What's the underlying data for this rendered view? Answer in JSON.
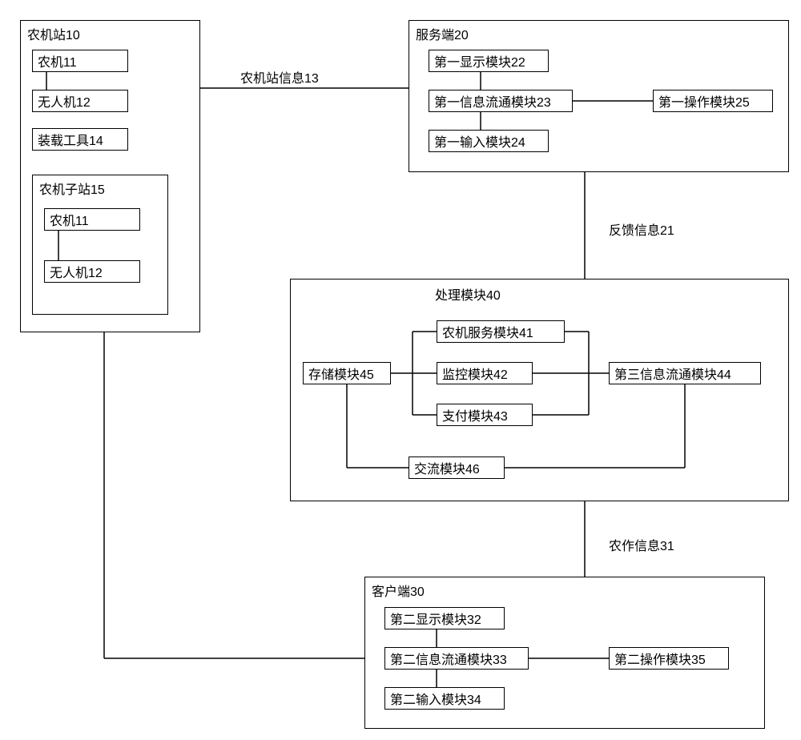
{
  "station_main": {
    "title": "农机站10",
    "machinery": "农机11",
    "drone": "无人机12",
    "loader": "装载工具14",
    "substation": {
      "title": "农机子站15",
      "machinery": "农机11",
      "drone": "无人机12"
    }
  },
  "server": {
    "title": "服务端20",
    "display": "第一显示模块22",
    "info_flow": "第一信息流通模块23",
    "input": "第一输入模块24",
    "operate": "第一操作模块25"
  },
  "processing": {
    "title": "处理模块40",
    "service": "农机服务模块41",
    "monitor": "监控模块42",
    "payment": "支付模块43",
    "info_flow3": "第三信息流通模块44",
    "storage": "存储模块45",
    "exchange": "交流模块46"
  },
  "client": {
    "title": "客户端30",
    "display": "第二显示模块32",
    "info_flow": "第二信息流通模块33",
    "input": "第二输入模块34",
    "operate": "第二操作模块35"
  },
  "edges": {
    "station_info": "农机站信息13",
    "feedback": "反馈信息21",
    "farming_info": "农作信息31"
  }
}
